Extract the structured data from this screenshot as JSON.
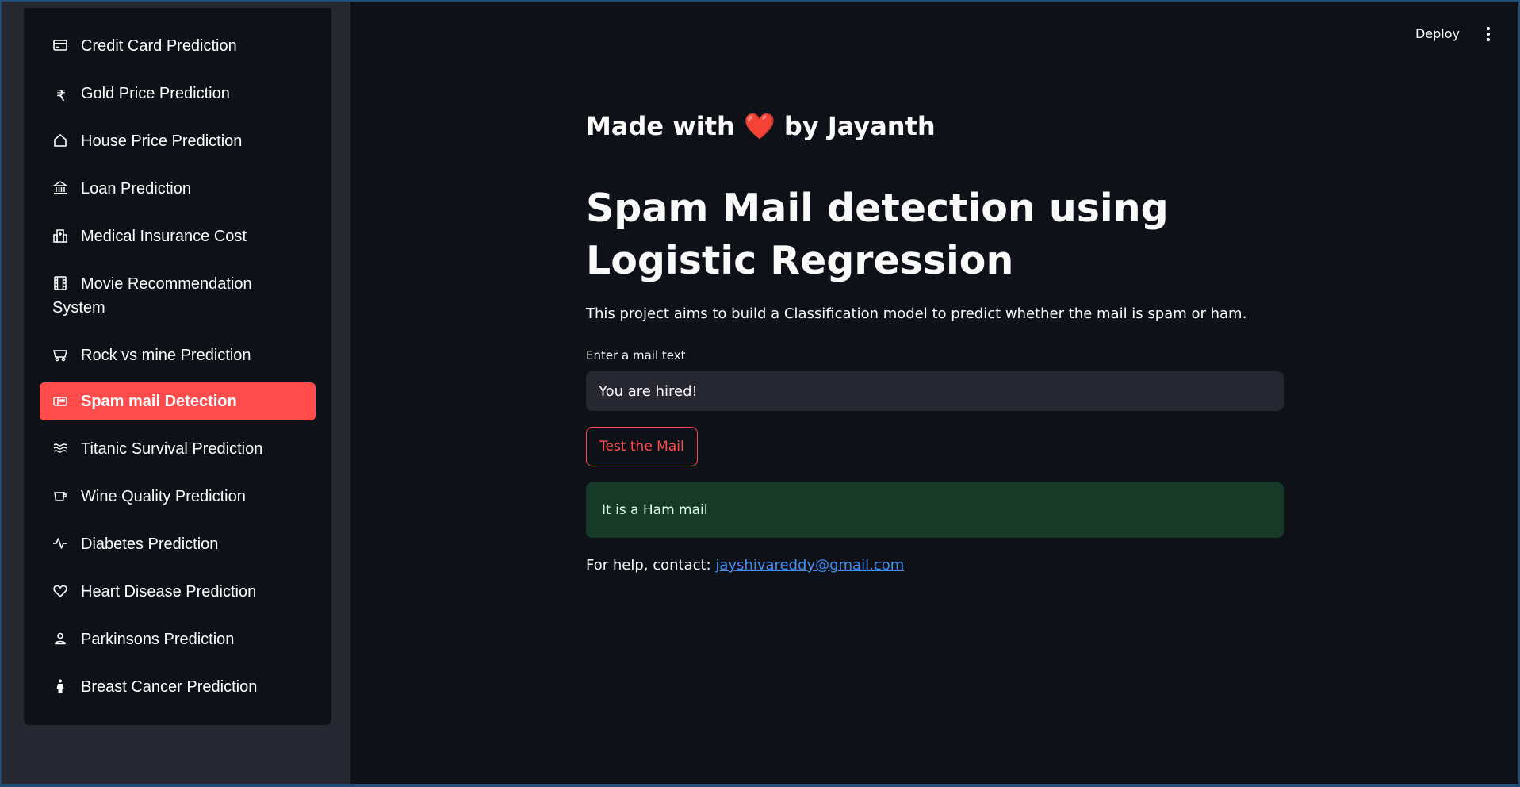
{
  "sidebar": {
    "items": [
      {
        "label": "Credit Card Prediction",
        "icon": "credit-card-icon"
      },
      {
        "label": "Gold Price Prediction",
        "icon": "rupee-icon"
      },
      {
        "label": "House Price Prediction",
        "icon": "house-icon"
      },
      {
        "label": "Loan Prediction",
        "icon": "bank-icon"
      },
      {
        "label": "Medical Insurance Cost",
        "icon": "hospital-icon"
      },
      {
        "label": "Movie Recommendation System",
        "icon": "film-icon"
      },
      {
        "label": "Rock vs mine Prediction",
        "icon": "minecart-icon"
      },
      {
        "label": "Spam mail Detection",
        "icon": "mailbox-icon",
        "active": true
      },
      {
        "label": "Titanic Survival Prediction",
        "icon": "water-icon"
      },
      {
        "label": "Wine Quality Prediction",
        "icon": "cup-icon"
      },
      {
        "label": "Diabetes Prediction",
        "icon": "activity-icon"
      },
      {
        "label": "Heart Disease Prediction",
        "icon": "heart-icon"
      },
      {
        "label": "Parkinsons Prediction",
        "icon": "person-icon"
      },
      {
        "label": "Breast Cancer Prediction",
        "icon": "woman-icon"
      }
    ]
  },
  "header": {
    "deploy_label": "Deploy",
    "menu_icon": "kebab-menu-icon"
  },
  "main": {
    "made_with_prefix": "Made with",
    "made_with_heart": "❤️",
    "made_with_suffix": "by Jayanth",
    "title": "Spam Mail detection using Logistic Regression",
    "description": "This project aims to build a Classification model to predict whether the mail is spam or ham.",
    "input_label": "Enter a mail text",
    "input_value": "You are hired!",
    "button_label": "Test the Mail",
    "result_text": "It is a Ham mail",
    "help_prefix": "For help, contact:",
    "help_email": "jayshivareddy@gmail.com"
  },
  "colors": {
    "accent": "#ff4b4b",
    "background": "#0e1117",
    "sidebar": "#262730",
    "success_bg": "#173928",
    "link": "#3b8ff0"
  }
}
